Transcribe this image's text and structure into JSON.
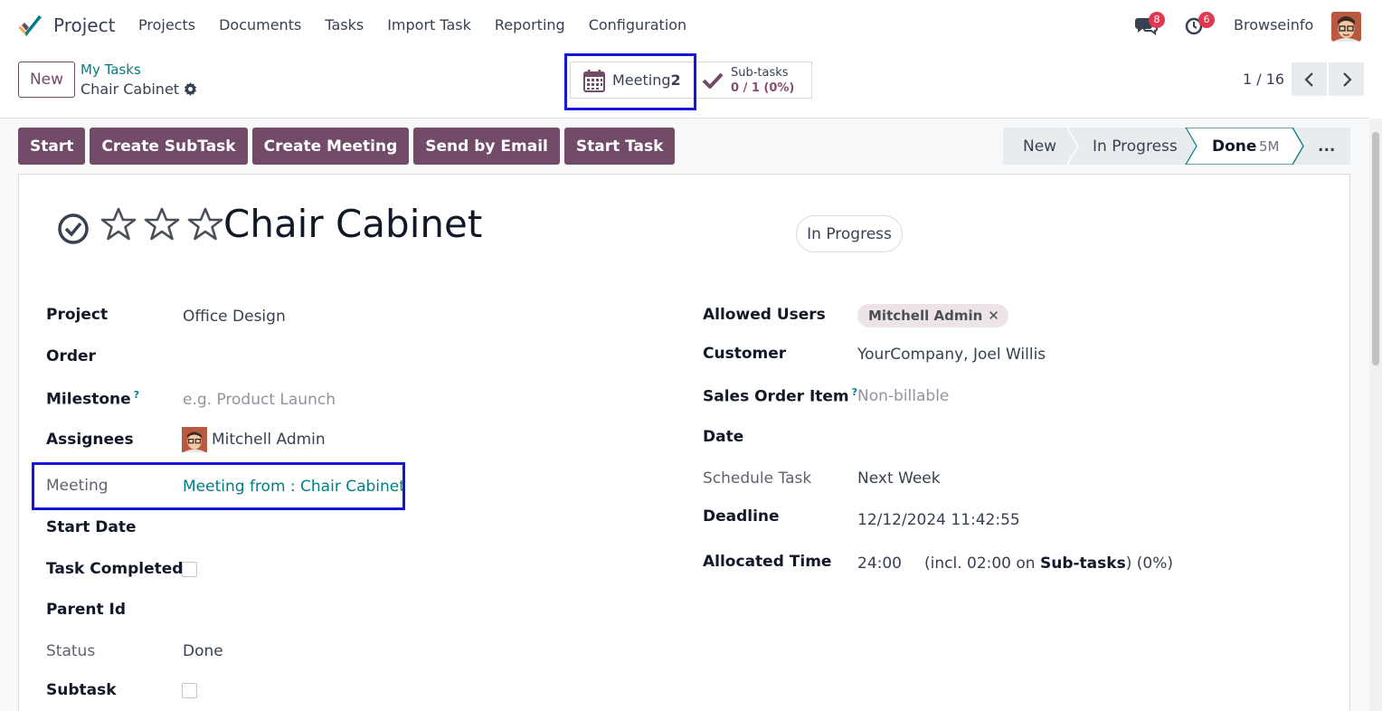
{
  "navbar": {
    "app_name": "Project",
    "menu": [
      "Projects",
      "Documents",
      "Tasks",
      "Import Task",
      "Reporting",
      "Configuration"
    ],
    "messages_badge": "8",
    "activities_badge": "6",
    "user_name": "Browseinfo"
  },
  "control_panel": {
    "new_label": "New",
    "breadcrumb_parent": "My Tasks",
    "breadcrumb_current": "Chair Cabinet",
    "smart_meeting_label": "Meeting",
    "smart_meeting_value": "2",
    "smart_subtasks_label": "Sub-tasks",
    "smart_subtasks_value": "0 / 1 (0%)",
    "pager": "1 / 16"
  },
  "actions": [
    "Start",
    "Create SubTask",
    "Create Meeting",
    "Send by Email",
    "Start Task"
  ],
  "statusbar": {
    "stages": [
      "New",
      "In Progress",
      "Done"
    ],
    "done_duration": "5M",
    "more": "...",
    "active": "Done"
  },
  "task": {
    "title": "Chair Cabinet",
    "state": "In Progress",
    "priority_stars": 3
  },
  "left_fields": {
    "project_label": "Project",
    "project_value": "Office Design",
    "order_label": "Order",
    "milestone_label": "Milestone",
    "milestone_placeholder": "e.g. Product Launch",
    "assignees_label": "Assignees",
    "assignees_value": "Mitchell Admin",
    "meeting_label": "Meeting",
    "meeting_value": "Meeting from : Chair Cabinet",
    "start_date_label": "Start Date",
    "task_completed_label": "Task Completed",
    "parent_id_label": "Parent Id",
    "status_label": "Status",
    "status_value": "Done",
    "subtask_label": "Subtask"
  },
  "right_fields": {
    "allowed_users_label": "Allowed Users",
    "allowed_users_tag": "Mitchell Admin",
    "customer_label": "Customer",
    "customer_value": "YourCompany, Joel Willis",
    "sales_order_item_label": "Sales Order Item",
    "sales_order_item_placeholder": "Non-billable",
    "date_label": "Date",
    "schedule_task_label": "Schedule Task",
    "schedule_task_value": "Next Week",
    "deadline_label": "Deadline",
    "deadline_value": "12/12/2024 11:42:55",
    "allocated_time_label": "Allocated Time",
    "allocated_time_value": "24:00",
    "allocated_incl_prefix": "(incl. 02:00 on",
    "allocated_incl_bold": "Sub-tasks",
    "allocated_incl_suffix": ") (0%)"
  },
  "colors": {
    "brand": "#714b67",
    "link": "#017e84",
    "highlight": "#1515d8",
    "badge": "#e0384e"
  }
}
